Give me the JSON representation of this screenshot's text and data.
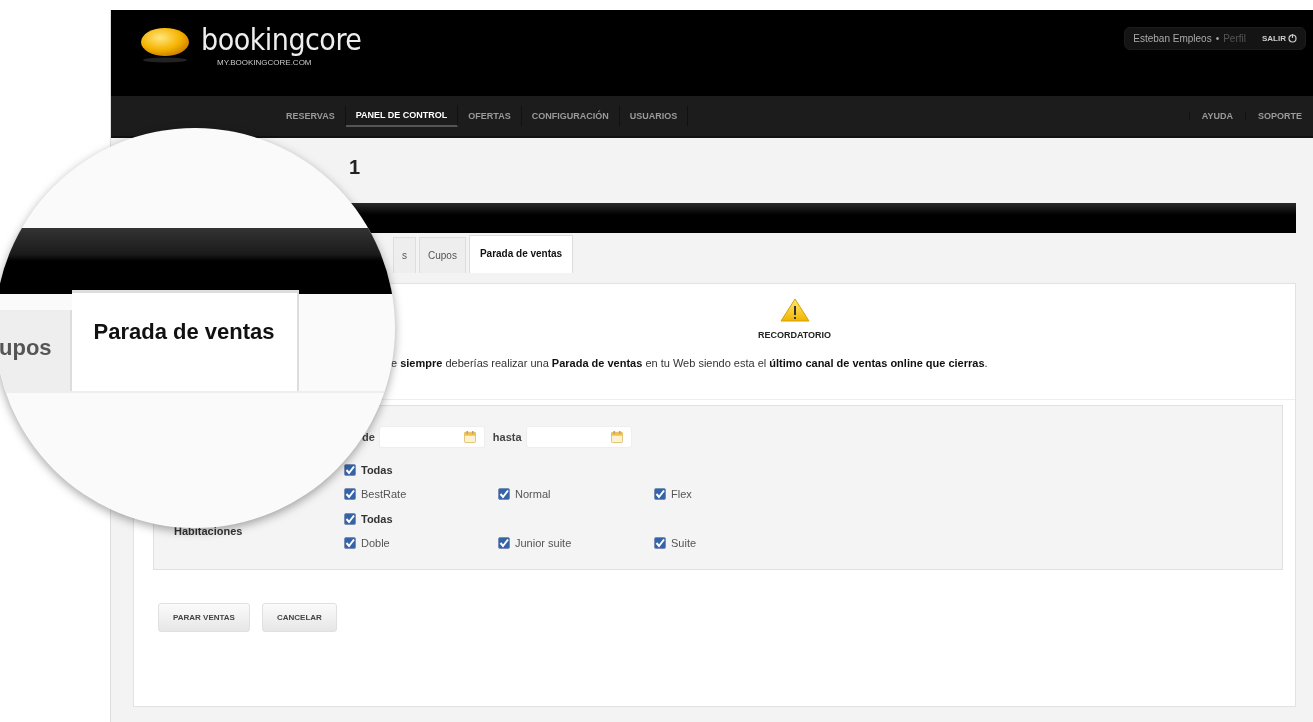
{
  "header": {
    "logo": {
      "name": "bookingcore",
      "url": "MY.BOOKINGCORE.COM"
    },
    "user": {
      "name": "Esteban Empleos",
      "separator": "•",
      "profile_link": "Perfil",
      "logout": "SALIR"
    }
  },
  "nav": {
    "items": [
      {
        "label": "RESERVAS",
        "selected": false
      },
      {
        "label": "PANEL DE CONTROL",
        "selected": true
      },
      {
        "label": "OFERTAS",
        "selected": false
      },
      {
        "label": "CONFIGURACIÓN",
        "selected": false
      },
      {
        "label": "USUARIOS",
        "selected": false
      }
    ],
    "right_items": [
      {
        "label": "AYUDA",
        "selected": false
      },
      {
        "label": "SOPORTE",
        "selected": false
      }
    ]
  },
  "page_title": "1",
  "tabs": [
    {
      "label": "s",
      "selected": false
    },
    {
      "label": "Cupos",
      "selected": false
    },
    {
      "label": "Parada de ventas",
      "selected": true
    }
  ],
  "notice": {
    "title": "RECORDATORIO",
    "text": "e **siempre** deberías realizar una **Parada de ventas** en tu Web siendo esta el **último canal de ventas online que cierras**."
  },
  "form": {
    "date_from_label": "de",
    "date_to_label": "hasta",
    "groups": [
      {
        "all": {
          "label": "Todas",
          "checked": true
        },
        "options": [
          {
            "label": "BestRate",
            "checked": true
          },
          {
            "label": "Normal",
            "checked": true
          },
          {
            "label": "Flex",
            "checked": true
          }
        ]
      },
      {
        "label": "Habitaciones",
        "all": {
          "label": "Todas",
          "checked": true
        },
        "options": [
          {
            "label": "Doble",
            "checked": true
          },
          {
            "label": "Junior suite",
            "checked": true
          },
          {
            "label": "Suite",
            "checked": true
          }
        ]
      }
    ]
  },
  "buttons": [
    {
      "label": "PARAR VENTAS"
    },
    {
      "label": "CANCELAR"
    }
  ],
  "magnifier": {
    "tabs": [
      {
        "label": "upos",
        "selected": false
      },
      {
        "label": "Parada de ventas",
        "selected": true
      }
    ]
  }
}
